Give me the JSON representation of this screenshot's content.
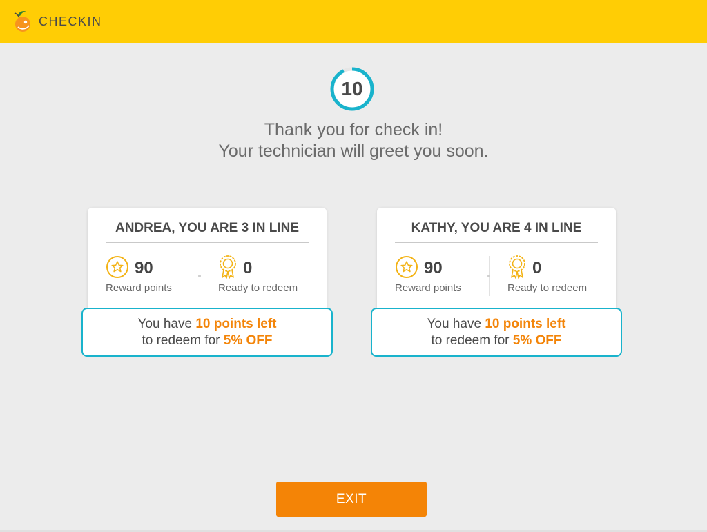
{
  "header": {
    "app_title": "CHECKIN",
    "logo_icon": "orange-fruit-icon",
    "background_color": "#ffcd05"
  },
  "countdown": {
    "value": "10",
    "ring_color": "#19b3cc",
    "progress_fraction": 0.93
  },
  "message": {
    "line1": "Thank you for check in!",
    "line2": "Your technician will greet you soon."
  },
  "customers": [
    {
      "title": "ANDREA, YOU ARE 3 IN LINE",
      "reward_points": "90",
      "reward_label": "Reward points",
      "reward_icon": "star-badge-icon",
      "redeem_count": "0",
      "redeem_label": "Ready to redeem",
      "redeem_icon": "award-ribbon-icon",
      "promo": {
        "prefix": "You have ",
        "highlight1": "10 points left",
        "middle": "to redeem for ",
        "highlight2": "5% OFF"
      }
    },
    {
      "title": "KATHY, YOU ARE 4 IN LINE",
      "reward_points": "90",
      "reward_label": "Reward points",
      "reward_icon": "star-badge-icon",
      "redeem_count": "0",
      "redeem_label": "Ready to redeem",
      "redeem_icon": "award-ribbon-icon",
      "promo": {
        "prefix": "You have ",
        "highlight1": "10 points left",
        "middle": "to redeem for ",
        "highlight2": "5% OFF"
      }
    }
  ],
  "exit_button": {
    "label": "EXIT",
    "color": "#f48406"
  },
  "colors": {
    "accent_orange": "#f3850a",
    "accent_teal": "#19b3cc",
    "icon_gold": "#f3b316"
  }
}
